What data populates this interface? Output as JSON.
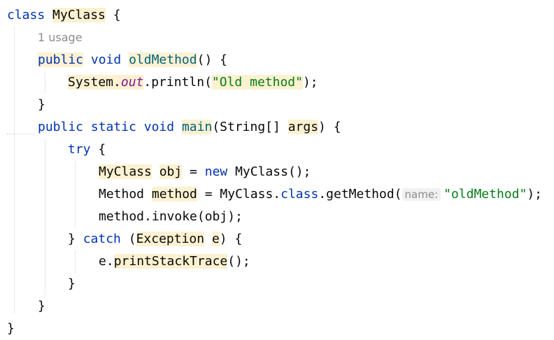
{
  "editor": {
    "language": "Java",
    "usage_hint": "1 usage",
    "param_hint": "name:",
    "tokens": {
      "class_kw": "class",
      "class_name": "MyClass",
      "open_brace": " {",
      "public_kw": "public",
      "void_kw": "void",
      "static_kw": "static",
      "old_method_name": "oldMethod",
      "empty_params": "() {",
      "system_prefix": "System.",
      "out_field": "out",
      "println_call": ".println(",
      "old_method_str": "\"Old method\"",
      "close_call": ");",
      "close_brace": "}",
      "main_name": "main",
      "main_params_open": "(String[] ",
      "args_param": "args",
      "main_params_close": ") {",
      "try_kw": "try",
      "obj_type": "MyClass",
      "obj_var": "obj",
      "assign": " = ",
      "new_kw": "new",
      "new_ctor": " MyClass();",
      "method_type": "Method",
      "method_var": "method",
      "myclass_dot": "MyClass.",
      "class_literal": "class",
      "get_method_call": ".getMethod(",
      "oldmethod_str": "\"oldMethod\"",
      "invoke_stmt": "method.invoke(obj);",
      "close_brace_space": "} ",
      "catch_kw": "catch",
      "exception_open": " (",
      "exception_type": "Exception",
      "exception_var": "e",
      "exception_close": ") {",
      "e_dot": "e.",
      "print_stack_trace": "printStackTrace",
      "empty_call_end": "();"
    }
  }
}
